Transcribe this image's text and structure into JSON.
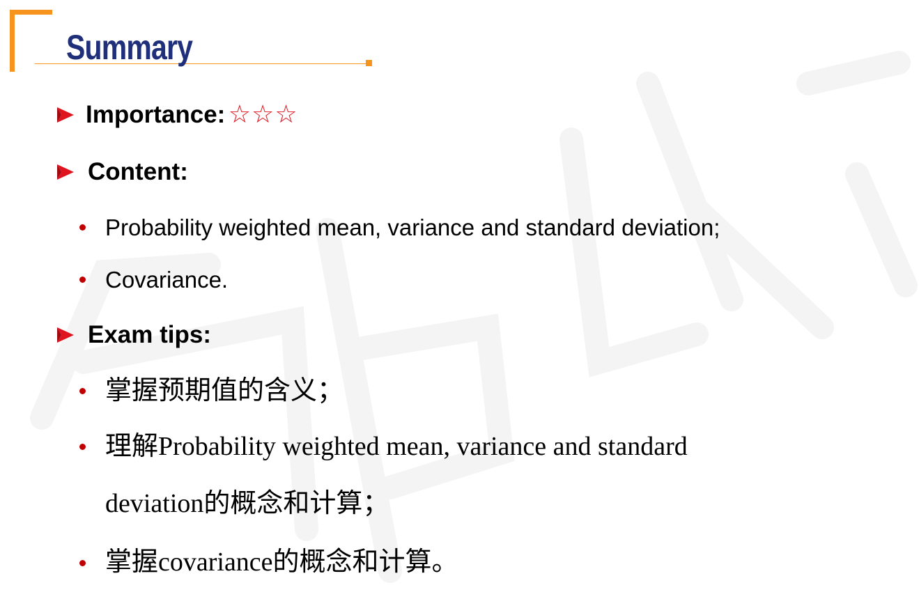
{
  "title": "Summary",
  "importance": {
    "label": "Importance:",
    "stars": "☆☆☆"
  },
  "content": {
    "label": "Content:",
    "items": [
      "Probability weighted mean, variance and standard deviation;",
      "Covariance."
    ]
  },
  "exam_tips": {
    "label": "Exam tips:",
    "items": [
      "掌握预期值的含义；",
      "理解Probability weighted mean, variance and standard",
      "deviation的概念和计算；",
      "掌握covariance的概念和计算。"
    ]
  },
  "watermark": "高顿教育",
  "colors": {
    "title": "#1f2f7a",
    "accent_orange": "#f7941d",
    "bullet_red": "#c00000",
    "star_red": "#e0141e",
    "arrow_red": "#e0141e"
  }
}
